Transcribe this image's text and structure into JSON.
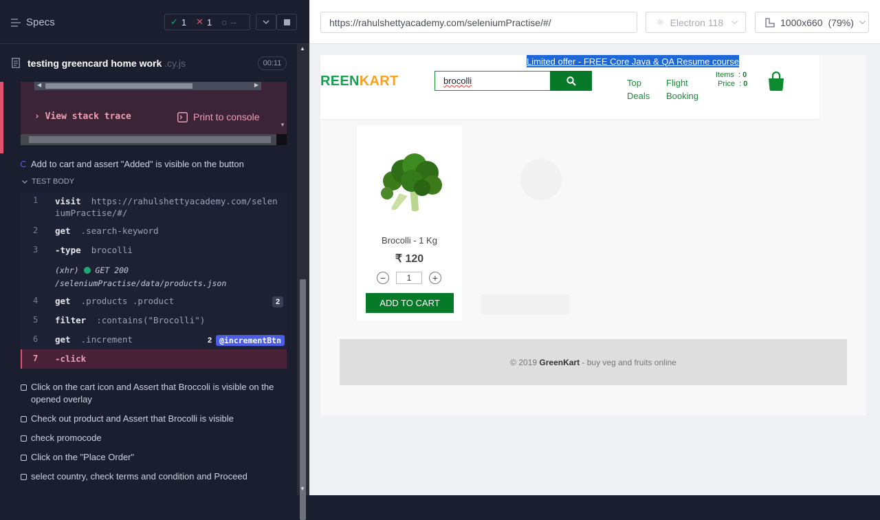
{
  "runner": {
    "specs_label": "Specs",
    "stats": {
      "passed": "1",
      "failed": "1",
      "pending": "--"
    },
    "file_name": "testing greencard home work",
    "file_ext": ".cy.js",
    "timer": "00:11",
    "error": {
      "stack_label": "View stack trace",
      "print_label": "Print to console"
    },
    "current_test": "Add to cart and assert \"Added\" is visible on the button",
    "test_body_label": "TEST BODY",
    "commands": [
      {
        "num": "1",
        "name": "visit",
        "arg": "https://rahulshettyacademy.com/seleniumPractise/#/"
      },
      {
        "num": "2",
        "name": "get",
        "arg": ".search-keyword"
      },
      {
        "num": "3",
        "name": "-type",
        "arg": "brocolli"
      },
      {
        "num": "",
        "name": "(xhr)",
        "arg": "GET 200 /seleniumPractise/data/products.json"
      },
      {
        "num": "4",
        "name": "get",
        "arg": ".products .product",
        "count": "2"
      },
      {
        "num": "5",
        "name": "filter",
        "arg": ":contains(\"Brocolli\")"
      },
      {
        "num": "6",
        "name": "get",
        "arg": ".increment",
        "count": "2",
        "alias": "@incrementBtn"
      },
      {
        "num": "7",
        "name": "-click",
        "arg": ""
      }
    ],
    "todos": [
      "Click on the cart icon and Assert that Broccoli is visible on the opened overlay",
      "Check out product and Assert that Brocolli is visible",
      "check promocode",
      "Click on the \"Place Order\"",
      "select country, check terms and condition and Proceed"
    ]
  },
  "browser": {
    "url": "https://rahulshettyacademy.com/seleniumPractise/#/",
    "engine": "Electron 118",
    "viewport": "1000x660",
    "zoom": "(79%)"
  },
  "app": {
    "offer": "Limited offer - FREE Core Java & QA Resume course",
    "logo_a": "REEN",
    "logo_b": "KART",
    "search_value": "brocolli",
    "nav": {
      "top": "Top",
      "deals": "Deals",
      "flight": "Flight",
      "booking": "Booking"
    },
    "items_label": "Items  :",
    "items_value": "0",
    "price_label": "Price  :",
    "price_value": "0",
    "product": {
      "name": "Brocolli - 1 Kg",
      "price": "₹ 120",
      "qty": "1",
      "add_label": "ADD TO CART"
    },
    "footer": {
      "prefix": "© 2019 ",
      "brand": "GreenKart",
      "suffix": " - buy veg and fruits online"
    }
  }
}
